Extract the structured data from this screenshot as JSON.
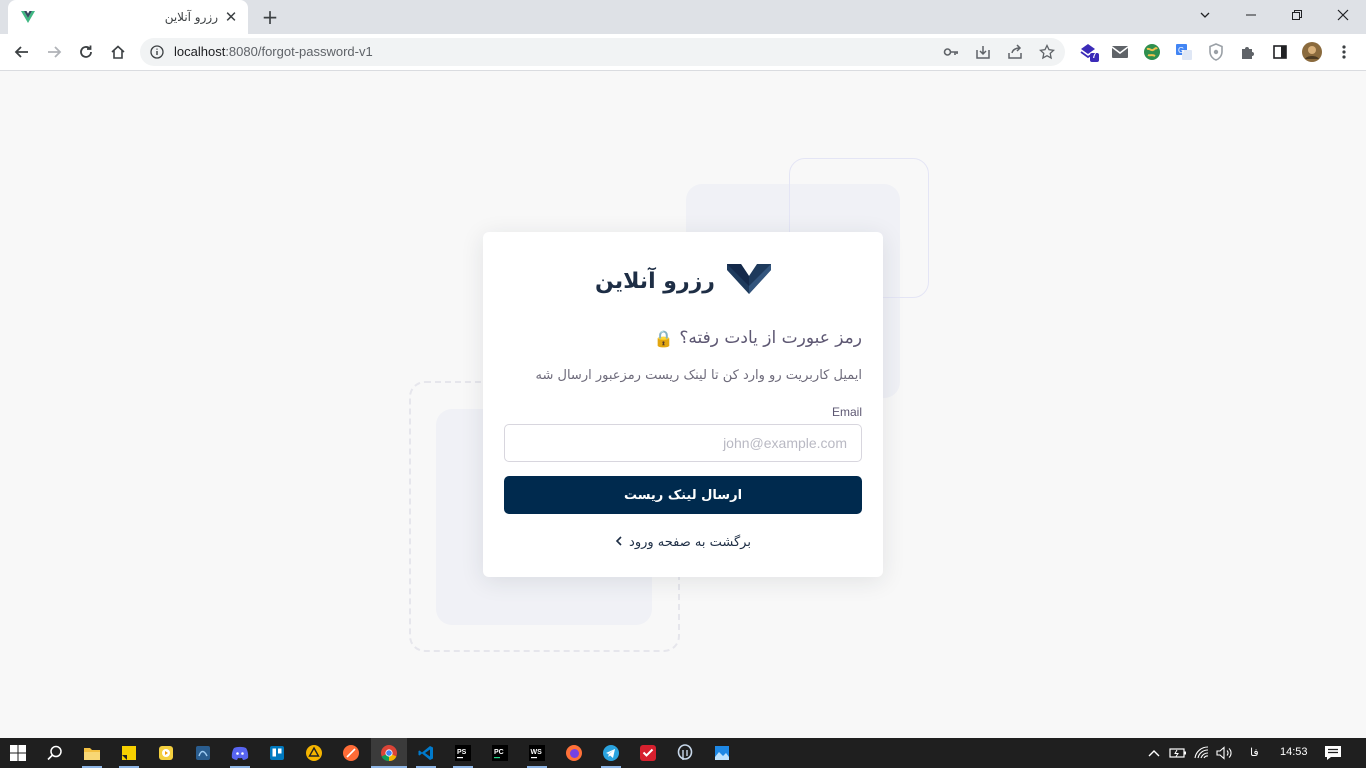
{
  "browser": {
    "tab_title": "رزرو آنلاین",
    "url_host": "localhost",
    "url_rest": ":8080/forgot-password-v1",
    "extension_badge": "7"
  },
  "brand": {
    "name": "رزرو آنلاین"
  },
  "form": {
    "heading": "رمز عبورت از یادت رفته؟",
    "heading_emoji": "🔒",
    "description": "ایمیل کاربریت رو وارد کن تا لینک ریست رمزعبور ارسال شه",
    "email_label": "Email",
    "email_placeholder": "john@example.com",
    "email_value": "",
    "submit_label": "ارسال لینک ریست",
    "back_label": "برگشت به صفحه ورود"
  },
  "taskbar": {
    "language": "فا",
    "clock": "14:53"
  },
  "colors": {
    "primary": "#002a4e",
    "brand_text": "#1e2e45",
    "page_bg": "#f8f8f8",
    "deco": "#f0f1f6"
  }
}
